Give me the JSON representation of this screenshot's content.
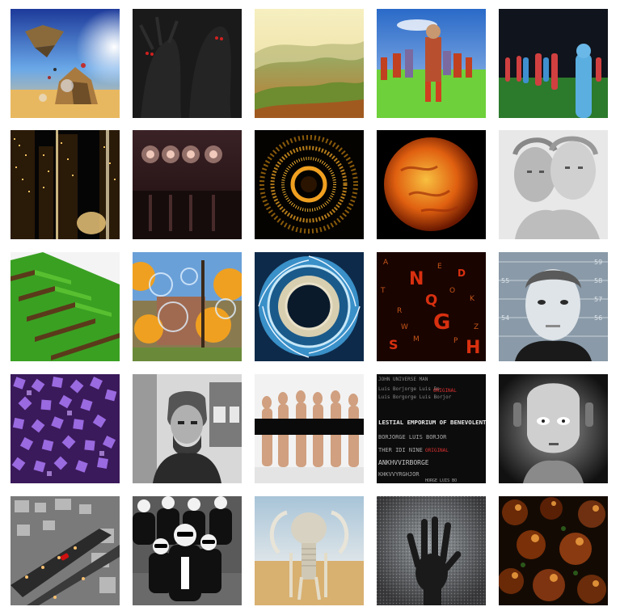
{
  "gallery": {
    "tiles": [
      {
        "name": "surreal-desert-floating-island-thumbnail",
        "label": ""
      },
      {
        "name": "dark-shadow-figures-red-eyes-thumbnail",
        "label": ""
      },
      {
        "name": "foggy-green-hills-thumbnail",
        "label": ""
      },
      {
        "name": "crowd-of-3d-fighters-on-grass-thumbnail",
        "label": ""
      },
      {
        "name": "blue-and-red-mannequins-crowd-thumbnail",
        "label": ""
      },
      {
        "name": "glowing-city-towers-night-thumbnail",
        "label": ""
      },
      {
        "name": "star-lights-on-wall-reflection-thumbnail",
        "label": ""
      },
      {
        "name": "orange-particle-ring-thumbnail",
        "label": ""
      },
      {
        "name": "fiery-sun-sphere-thumbnail",
        "label": ""
      },
      {
        "name": "marble-busts-statue-thumbnail",
        "label": ""
      },
      {
        "name": "voxel-grass-terrain-thumbnail",
        "label": ""
      },
      {
        "name": "bubbles-autumn-street-thumbnail",
        "label": ""
      },
      {
        "name": "blue-spiral-tunnel-thumbnail",
        "label": ""
      },
      {
        "name": "red-falling-letters-thumbnail",
        "label": ""
      },
      {
        "name": "mugshot-portrait-thumbnail",
        "label": ""
      },
      {
        "name": "purple-cube-field-thumbnail",
        "label": ""
      },
      {
        "name": "engraved-man-portrait-thumbnail",
        "label": ""
      },
      {
        "name": "figures-behind-black-bar-thumbnail",
        "label": ""
      },
      {
        "name": "scrolling-text-terminal-thumbnail",
        "label": ""
      },
      {
        "name": "robot-face-metropolis-thumbnail",
        "label": ""
      },
      {
        "name": "gray-city-road-red-car-thumbnail",
        "label": ""
      },
      {
        "name": "dancing-sunglasses-crowd-thumbnail",
        "label": ""
      },
      {
        "name": "mammoth-skeleton-desert-thumbnail",
        "label": ""
      },
      {
        "name": "hand-on-noisy-glass-thumbnail",
        "label": ""
      },
      {
        "name": "orange-glass-spheres-thumbnail",
        "label": ""
      }
    ],
    "scatter_text": {
      "letters_tile": [
        "N",
        "Q",
        "G",
        "H",
        "S",
        "D",
        "A",
        "R",
        "K",
        "M",
        "O",
        "T",
        "Z",
        "E",
        "W",
        "P"
      ],
      "terminal_lines": [
        "JOHN UNIVERSE MAN",
        "LESTIAL EMPORIUM OF BENEVOLENT KNOW",
        "Luis Borjorge Luis Bo",
        "THER IDI NINE",
        "ANKHVVIRBORGE",
        "Luis Borgorge Luis Borjor",
        "BORJORGE LUIS BORJOR",
        "KHKVVYRGHJOR",
        "HORGE LUIS BO"
      ],
      "terminal_highlight": "ORIGINAL",
      "mugshot_ruler": [
        "59",
        "58",
        "57",
        "56",
        "55",
        "54"
      ]
    },
    "colors": {
      "background": "#ffffff",
      "terminal_bg": "#0c0c0c",
      "terminal_text": "#d8d8d8",
      "terminal_highlight": "#e03030"
    }
  }
}
